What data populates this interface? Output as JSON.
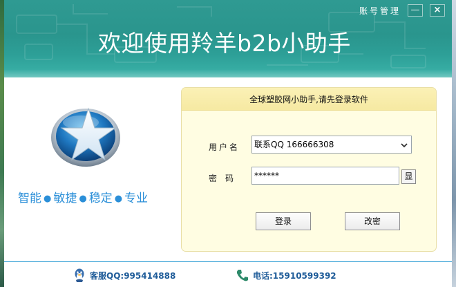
{
  "window": {
    "title": "账号管理",
    "min_label": "—",
    "close_label": "×"
  },
  "banner": {
    "title": "欢迎使用羚羊b2b小助手"
  },
  "logo": {
    "icon": "star-logo-icon"
  },
  "slogan": {
    "words": [
      "智能",
      "敏捷",
      "稳定",
      "专业"
    ],
    "separator": "●"
  },
  "login_panel": {
    "header": "全球塑胶网小助手,请先登录软件",
    "username_label": "用户名",
    "username_value": "联系QQ 166666308",
    "password_label": "密码",
    "password_value": "******",
    "show_password_label": "显",
    "login_button": "登录",
    "change_password_button": "改密"
  },
  "footer": {
    "support_qq": "客服QQ:995414888",
    "phone": "电话:15910599392"
  },
  "colors": {
    "header_teal": "#2f9a92",
    "slogan_blue": "#2b8fd8",
    "panel_yellow": "#fffde2",
    "footer_text": "#1f5c99"
  }
}
